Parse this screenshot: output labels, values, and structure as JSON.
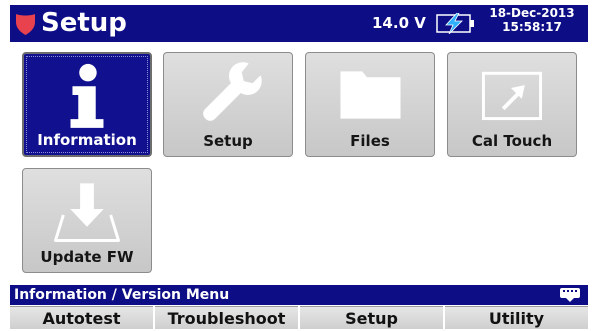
{
  "header": {
    "title": "Setup",
    "voltage": "14.0 V",
    "date": "18-Dec-2013",
    "time": "15:58:17"
  },
  "tiles": [
    {
      "label": "Information",
      "icon": "info-icon",
      "selected": true
    },
    {
      "label": "Setup",
      "icon": "wrench-icon",
      "selected": false
    },
    {
      "label": "Files",
      "icon": "folder-icon",
      "selected": false
    },
    {
      "label": "Cal Touch",
      "icon": "cal-touch-icon",
      "selected": false
    },
    {
      "label": "Update FW",
      "icon": "download-tray-icon",
      "selected": false
    }
  ],
  "status_bar": {
    "text": "Information / Version Menu"
  },
  "softkeys": [
    "Autotest",
    "Troubleshoot",
    "Setup",
    "Utility"
  ],
  "colors": {
    "header_bg": "#0d0d86",
    "selected_tile": "#111190",
    "shield": "#e8424f",
    "battery_bolt": "#2cb0ff"
  }
}
